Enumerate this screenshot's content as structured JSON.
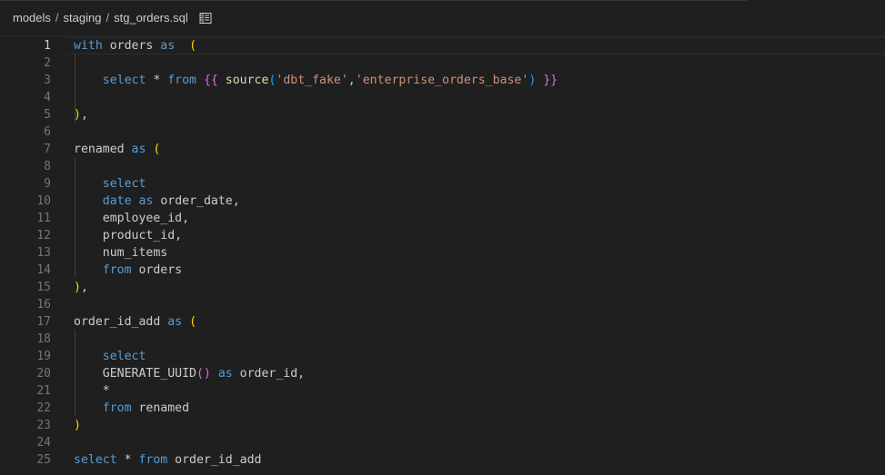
{
  "breadcrumb": {
    "folder1": "models",
    "folder2": "staging",
    "file": "stg_orders.sql",
    "separator": "/"
  },
  "icons": {
    "outline": "list-outline-icon"
  },
  "colors": {
    "keyword": "#569cd6",
    "function": "#dcdcaa",
    "string": "#ce9178",
    "bracket_level1": "#ffd700",
    "bracket_level2": "#da70d6",
    "bracket_level3": "#179fff",
    "text": "#cccccc",
    "background": "#1f1f1f"
  },
  "editor": {
    "current_line": 1,
    "lines": [
      {
        "n": "1",
        "tokens": [
          [
            "kw",
            "with"
          ],
          [
            "plain",
            " orders "
          ],
          [
            "kw",
            "as"
          ],
          [
            "plain",
            "  "
          ],
          [
            "br1",
            "("
          ]
        ]
      },
      {
        "n": "2",
        "tokens": []
      },
      {
        "n": "3",
        "tokens": [
          [
            "plain",
            "    "
          ],
          [
            "kw",
            "select"
          ],
          [
            "plain",
            " * "
          ],
          [
            "kw",
            "from"
          ],
          [
            "plain",
            " "
          ],
          [
            "br2",
            "{{"
          ],
          [
            "plain",
            " "
          ],
          [
            "fn",
            "source"
          ],
          [
            "br3",
            "("
          ],
          [
            "str",
            "'dbt_fake'"
          ],
          [
            "plain",
            ","
          ],
          [
            "str",
            "'enterprise_orders_base'"
          ],
          [
            "br3",
            ")"
          ],
          [
            "plain",
            " "
          ],
          [
            "br2",
            "}}"
          ]
        ]
      },
      {
        "n": "4",
        "tokens": []
      },
      {
        "n": "5",
        "tokens": [
          [
            "br1",
            ")"
          ],
          [
            "plain",
            ","
          ]
        ]
      },
      {
        "n": "6",
        "tokens": []
      },
      {
        "n": "7",
        "tokens": [
          [
            "plain",
            "renamed "
          ],
          [
            "kw",
            "as"
          ],
          [
            "plain",
            " "
          ],
          [
            "br1",
            "("
          ]
        ]
      },
      {
        "n": "8",
        "tokens": []
      },
      {
        "n": "9",
        "tokens": [
          [
            "plain",
            "    "
          ],
          [
            "kw",
            "select"
          ]
        ]
      },
      {
        "n": "10",
        "tokens": [
          [
            "plain",
            "    "
          ],
          [
            "kw",
            "date"
          ],
          [
            "plain",
            " "
          ],
          [
            "kw",
            "as"
          ],
          [
            "plain",
            " order_date,"
          ]
        ]
      },
      {
        "n": "11",
        "tokens": [
          [
            "plain",
            "    employee_id,"
          ]
        ]
      },
      {
        "n": "12",
        "tokens": [
          [
            "plain",
            "    product_id,"
          ]
        ]
      },
      {
        "n": "13",
        "tokens": [
          [
            "plain",
            "    num_items"
          ]
        ]
      },
      {
        "n": "14",
        "tokens": [
          [
            "plain",
            "    "
          ],
          [
            "kw",
            "from"
          ],
          [
            "plain",
            " orders"
          ]
        ]
      },
      {
        "n": "15",
        "tokens": [
          [
            "br1",
            ")"
          ],
          [
            "plain",
            ","
          ]
        ]
      },
      {
        "n": "16",
        "tokens": []
      },
      {
        "n": "17",
        "tokens": [
          [
            "plain",
            "order_id_add "
          ],
          [
            "kw",
            "as"
          ],
          [
            "plain",
            " "
          ],
          [
            "br1",
            "("
          ]
        ]
      },
      {
        "n": "18",
        "tokens": []
      },
      {
        "n": "19",
        "tokens": [
          [
            "plain",
            "    "
          ],
          [
            "kw",
            "select"
          ]
        ]
      },
      {
        "n": "20",
        "tokens": [
          [
            "plain",
            "    GENERATE_UUID"
          ],
          [
            "br2",
            "()"
          ],
          [
            "plain",
            " "
          ],
          [
            "kw",
            "as"
          ],
          [
            "plain",
            " order_id,"
          ]
        ]
      },
      {
        "n": "21",
        "tokens": [
          [
            "plain",
            "    *"
          ]
        ]
      },
      {
        "n": "22",
        "tokens": [
          [
            "plain",
            "    "
          ],
          [
            "kw",
            "from"
          ],
          [
            "plain",
            " renamed"
          ]
        ]
      },
      {
        "n": "23",
        "tokens": [
          [
            "br1",
            ")"
          ]
        ]
      },
      {
        "n": "24",
        "tokens": []
      },
      {
        "n": "25",
        "tokens": [
          [
            "kw",
            "select"
          ],
          [
            "plain",
            " * "
          ],
          [
            "kw",
            "from"
          ],
          [
            "plain",
            " order_id_add"
          ]
        ]
      }
    ]
  }
}
